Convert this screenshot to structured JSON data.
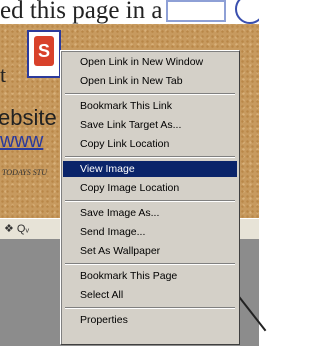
{
  "page": {
    "top_text": "ed this page in a",
    "side_t": "t",
    "side_ebsite": "ebsite",
    "side_www": "www",
    "side_small": "TODAYS\nSTU",
    "logo_letter": "S",
    "toolbar_icons": "❖  Qᵥ"
  },
  "menu": {
    "items": [
      {
        "label": "Open Link in New Window",
        "separator_after": false
      },
      {
        "label": "Open Link in New Tab",
        "separator_after": true
      },
      {
        "label": "Bookmark This Link",
        "separator_after": false
      },
      {
        "label": "Save Link Target As...",
        "separator_after": false
      },
      {
        "label": "Copy Link Location",
        "separator_after": true
      },
      {
        "label": "View Image",
        "separator_after": false,
        "highlighted": true
      },
      {
        "label": "Copy Image Location",
        "separator_after": true
      },
      {
        "label": "Save Image As...",
        "separator_after": false
      },
      {
        "label": "Send Image...",
        "separator_after": false
      },
      {
        "label": "Set As Wallpaper",
        "separator_after": true
      },
      {
        "label": "Bookmark This Page",
        "separator_after": false
      },
      {
        "label": "Select All",
        "separator_after": true
      },
      {
        "label": "Properties",
        "separator_after": false
      }
    ]
  },
  "colors": {
    "highlight": "#0a246a",
    "menu_bg": "#d4d0c8"
  },
  "icons": [
    "mouse-pointer-icon"
  ]
}
